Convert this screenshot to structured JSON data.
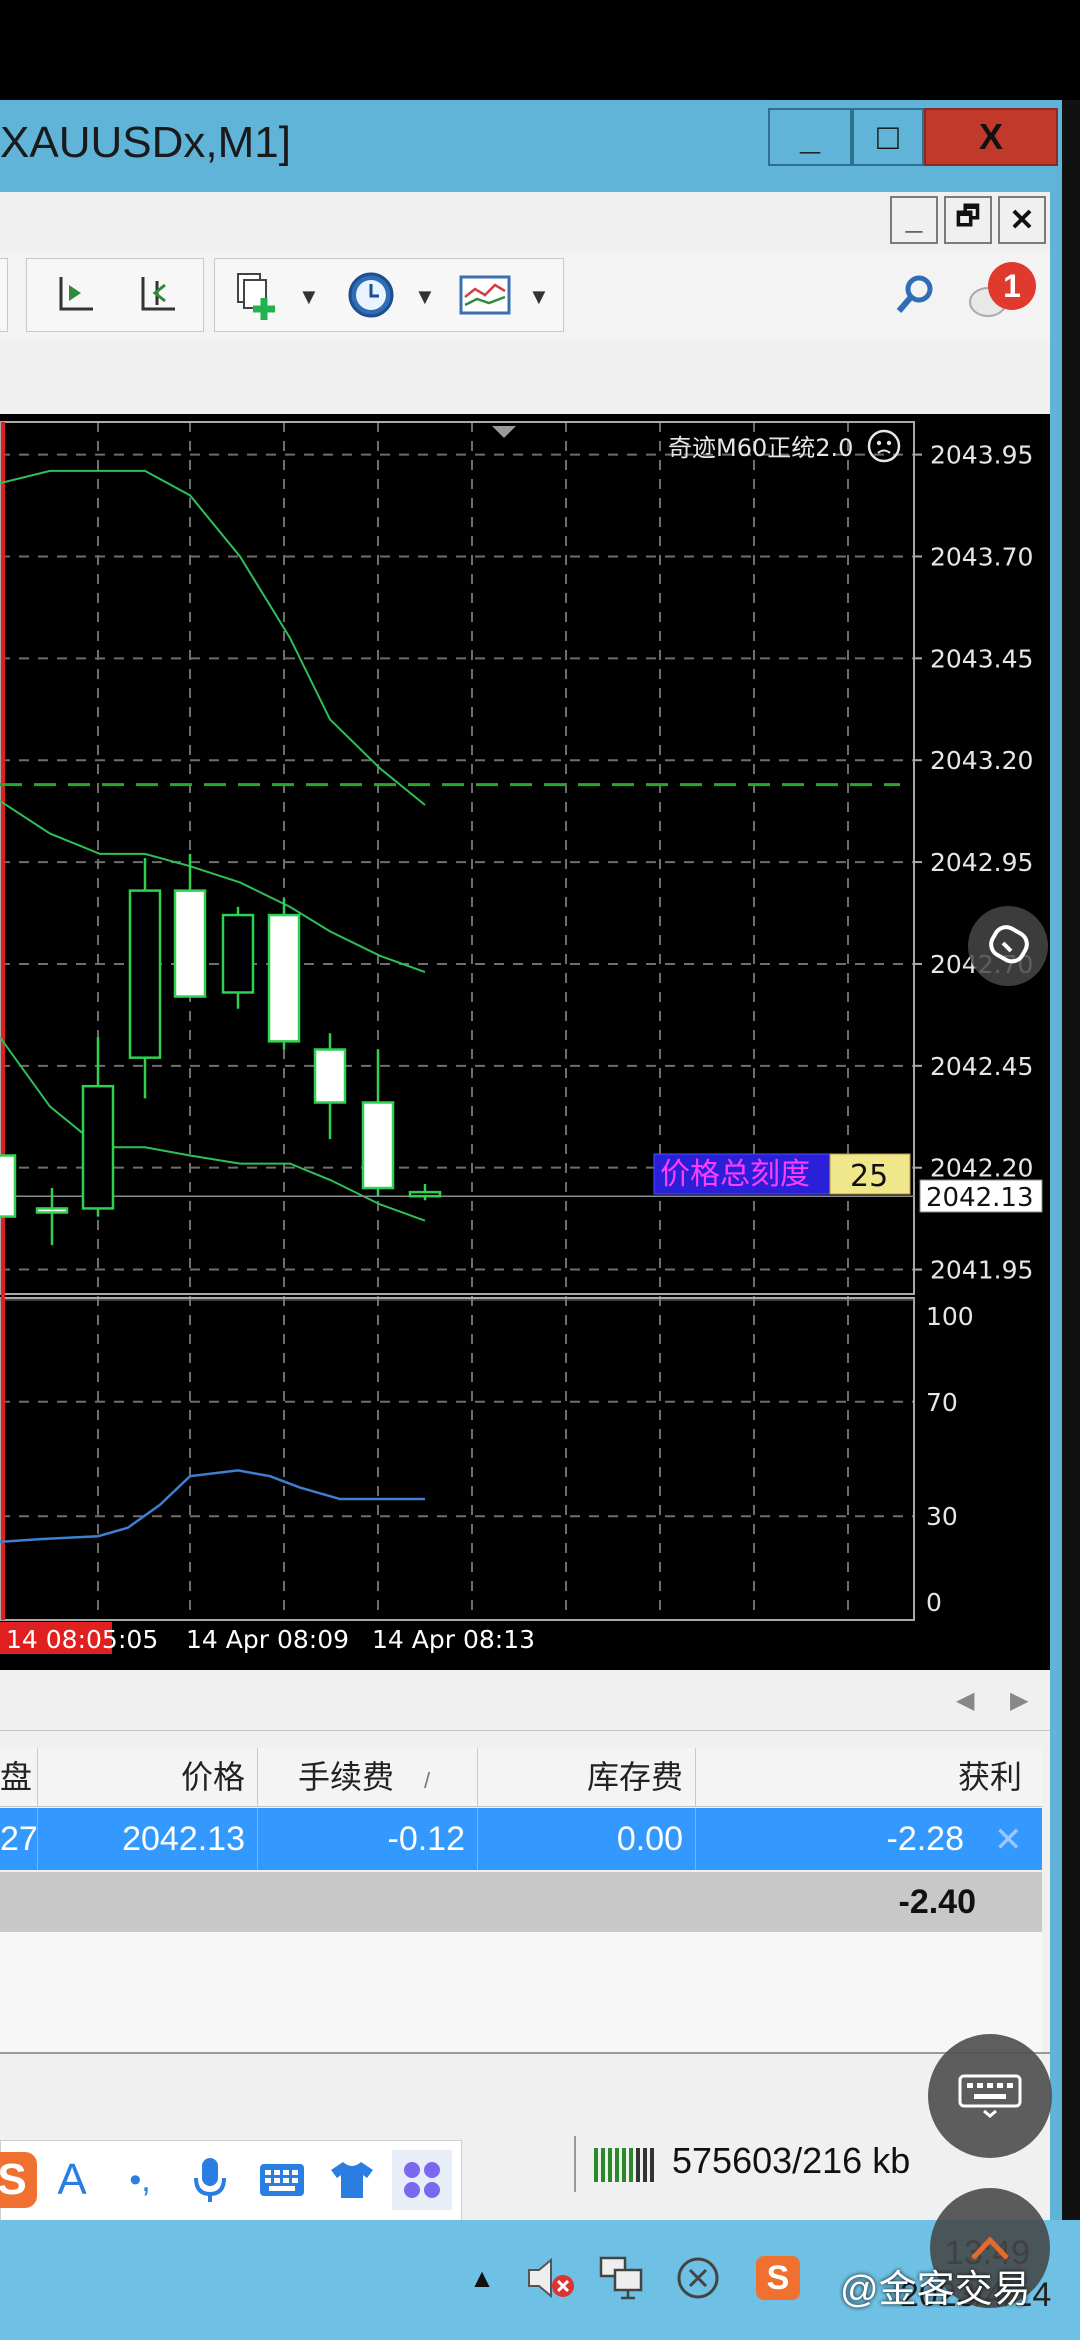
{
  "window": {
    "title": "XAUUSDx,M1]",
    "min_glyph": "_",
    "max_glyph": "□",
    "close_glyph": "X"
  },
  "mdi": {
    "min_glyph": "_",
    "restore_glyph": "🗗",
    "close_glyph": "✕"
  },
  "notification_count": "1",
  "chart": {
    "indicator_label": "奇迹M60正统2.0",
    "price_scale_label": "价格总刻度",
    "price_scale_value": "25",
    "current_price": "2042.13",
    "time_labels": [
      "14 08:05",
      ":05",
      "14 Apr 08:09",
      "14 Apr 08:13"
    ]
  },
  "chart_data": {
    "type": "candlestick",
    "y_ticks": [
      "2043.95",
      "2043.70",
      "2043.45",
      "2043.20",
      "2042.95",
      "2042.70",
      "2042.45",
      "2042.20",
      "2041.95"
    ],
    "y_tick_values": [
      2043.95,
      2043.7,
      2043.45,
      2043.2,
      2042.95,
      2042.7,
      2042.45,
      2042.2,
      2041.95
    ],
    "ylim": [
      2041.89,
      2044.03
    ],
    "dashed_level": 2043.14,
    "candles": [
      {
        "o": 2042.23,
        "h": 2042.23,
        "l": 2042.1,
        "c": 2042.08
      },
      {
        "o": 2042.1,
        "h": 2042.15,
        "l": 2042.01,
        "c": 2042.09
      },
      {
        "o": 2042.1,
        "h": 2042.52,
        "l": 2042.08,
        "c": 2042.4
      },
      {
        "o": 2042.47,
        "h": 2042.96,
        "l": 2042.37,
        "c": 2042.88
      },
      {
        "o": 2042.88,
        "h": 2042.97,
        "l": 2042.65,
        "c": 2042.62
      },
      {
        "o": 2042.63,
        "h": 2042.84,
        "l": 2042.59,
        "c": 2042.82
      },
      {
        "o": 2042.82,
        "h": 2042.86,
        "l": 2042.49,
        "c": 2042.51
      },
      {
        "o": 2042.49,
        "h": 2042.53,
        "l": 2042.27,
        "c": 2042.36
      },
      {
        "o": 2042.36,
        "h": 2042.49,
        "l": 2042.13,
        "c": 2042.15
      },
      {
        "o": 2042.13,
        "h": 2042.16,
        "l": 2042.12,
        "c": 2042.14
      }
    ],
    "oscillator": {
      "y_ticks": [
        "100",
        "70",
        "30",
        "0"
      ],
      "y_tick_values": [
        100,
        70,
        30,
        0
      ],
      "values": [
        21,
        22,
        23,
        26,
        34,
        44,
        46,
        44,
        40,
        36,
        36,
        36
      ]
    }
  },
  "terminal": {
    "headers": [
      "盘",
      "价格",
      "手续费",
      "库存费",
      "获利"
    ],
    "header_sort_mark": "/",
    "row": [
      "27",
      "2042.13",
      "-0.12",
      "0.00",
      "-2.28"
    ],
    "row_close_glyph": "✕",
    "total": "-2.40"
  },
  "status": {
    "memory": "575603/216 kb"
  },
  "ime": {
    "letter": "A",
    "punct": "•,",
    "logo": "S"
  },
  "taskbar": {
    "clock_time": "13:49",
    "clock_date": "2023/4/14",
    "watermark": "@金客交易"
  },
  "colors": {
    "window_frame": "#5fb4d8",
    "selection": "#3399ff",
    "chart_bg": "#000000",
    "close_red": "#c0392b"
  }
}
